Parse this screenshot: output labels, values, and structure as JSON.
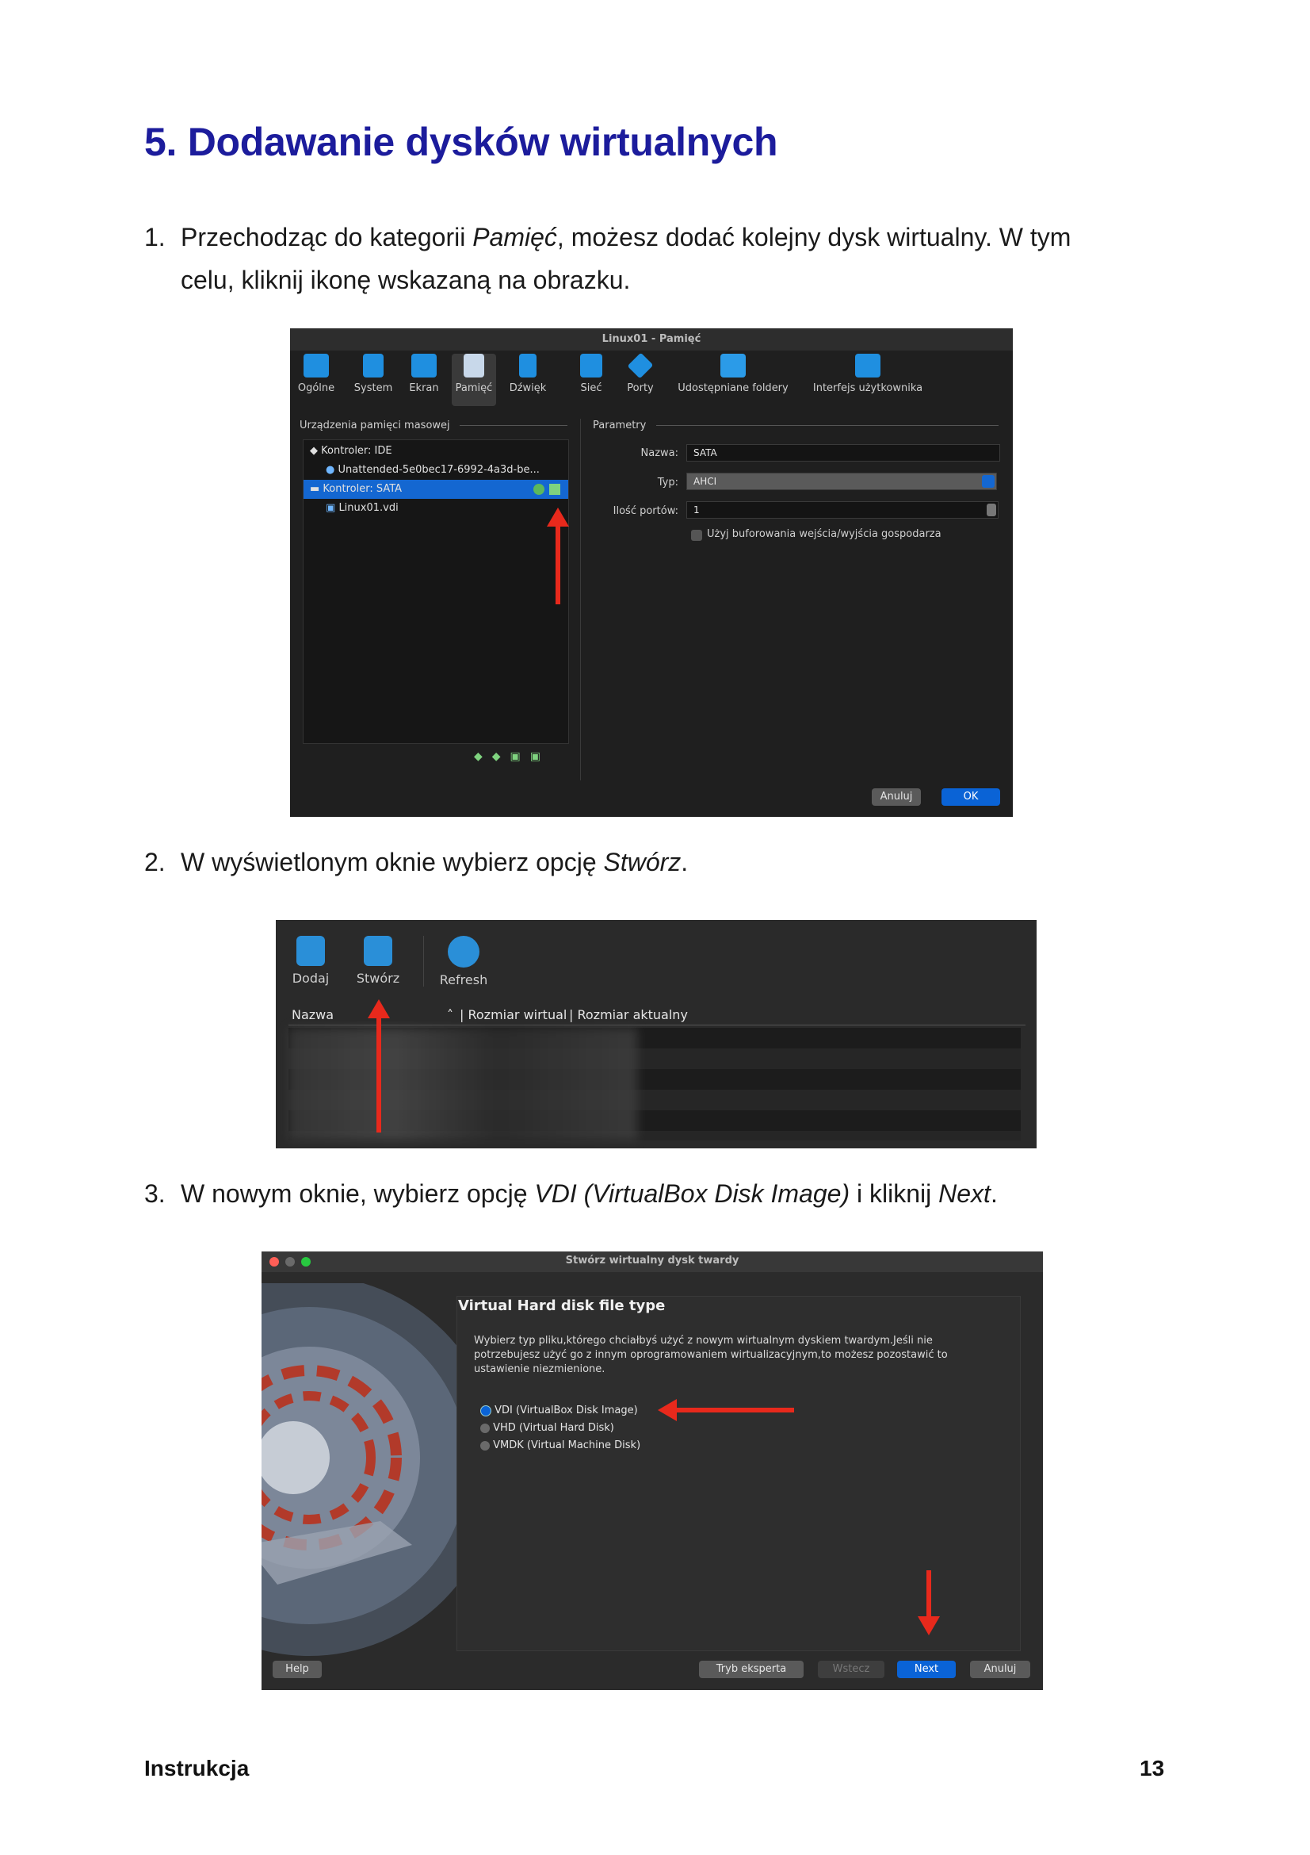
{
  "title": "5. Dodawanie dysków wirtualnych",
  "steps": [
    {
      "num": "1.",
      "line1_a": "Przechodząc do kategorii ",
      "line1_em": "Pamięć",
      "line1_b": ", możesz dodać kolejny dysk wirtualny. W tym",
      "line2": "celu, kliknij ikonę wskazaną na obrazku."
    },
    {
      "num": "2.",
      "a": "W wyświetlonym oknie wybierz opcję ",
      "em": "Stwórz",
      "b": "."
    },
    {
      "num": "3.",
      "a": "W nowym oknie, wybierz opcję ",
      "em": "VDI (VirtualBox Disk Image)",
      "b": " i kliknij ",
      "em2": "Next",
      "c": "."
    }
  ],
  "shot1": {
    "window_title": "Linux01 - Pamięć",
    "toolbar": [
      "Ogólne",
      "System",
      "Ekran",
      "Pamięć",
      "Dźwięk",
      "Sieć",
      "Porty",
      "Udostępniane foldery",
      "Interfejs użytkownika"
    ],
    "left_section": "Urządzenia pamięci masowej",
    "right_section": "Parametry",
    "tree": [
      "Kontroler: IDE",
      "Unattended-5e0bec17-6992-4a3d-be...",
      "Kontroler: SATA",
      "Linux01.vdi"
    ],
    "name_label": "Nazwa:",
    "name_value": "SATA",
    "type_label": "Typ:",
    "type_value": "AHCI",
    "ports_label": "Ilość portów:",
    "ports_value": "1",
    "checkbox_label": "Użyj buforowania wejścia/wyjścia gospodarza",
    "cancel": "Anuluj",
    "ok": "OK"
  },
  "shot2": {
    "toolbar": [
      "Dodaj",
      "Stwórz",
      "Refresh"
    ],
    "columns": [
      "Nazwa",
      "Rozmiar wirtual",
      "Rozmiar aktualny"
    ]
  },
  "shot3": {
    "window_title": "Stwórz wirtualny dysk twardy",
    "heading": "Virtual Hard disk file type",
    "description_1": "Wybierz typ pliku,którego chciałbyś użyć z nowym wirtualnym dyskiem twardym.Jeśli nie",
    "description_2": "potrzebujesz użyć go z innym oprogramowaniem wirtualizacyjnym,to możesz pozostawić to",
    "description_3": "ustawienie niezmienione.",
    "options": [
      "VDI (VirtualBox Disk Image)",
      "VHD (Virtual Hard Disk)",
      "VMDK (Virtual Machine Disk)"
    ],
    "buttons": {
      "help": "Help",
      "expert": "Tryb eksperta",
      "back": "Wstecz",
      "next": "Next",
      "cancel": "Anuluj"
    }
  },
  "footer": {
    "left": "Instrukcja",
    "page": "13"
  },
  "colors": {
    "title": "#1c1c9c",
    "arrow": "#e8291c",
    "accent": "#0a63d6"
  }
}
